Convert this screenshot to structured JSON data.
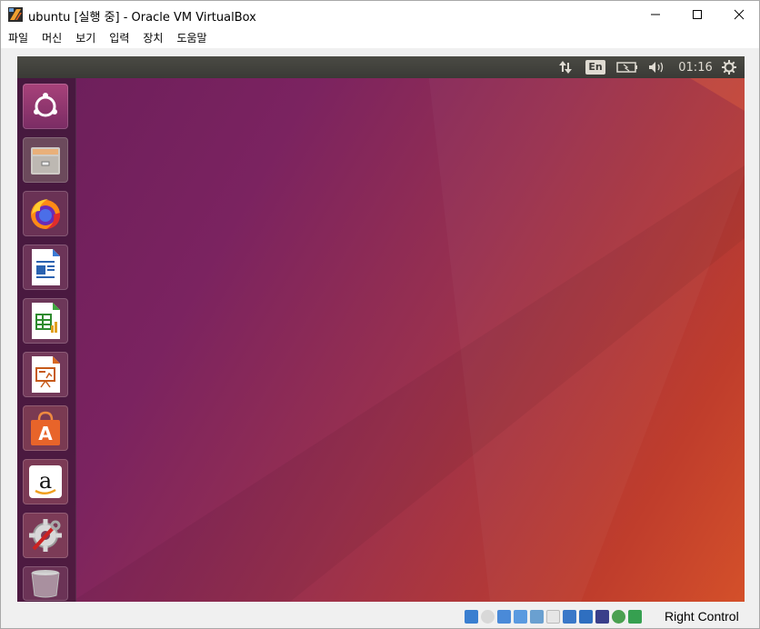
{
  "window": {
    "title": "ubuntu [실행 중] - Oracle VM VirtualBox"
  },
  "menu": [
    "파일",
    "머신",
    "보기",
    "입력",
    "장치",
    "도움말"
  ],
  "guest": {
    "panel": {
      "language": "En",
      "clock": "01:16"
    },
    "launcher": [
      {
        "name": "ubuntu-dash-icon"
      },
      {
        "name": "files-icon"
      },
      {
        "name": "firefox-icon"
      },
      {
        "name": "libreoffice-writer-icon"
      },
      {
        "name": "libreoffice-calc-icon"
      },
      {
        "name": "libreoffice-impress-icon"
      },
      {
        "name": "ubuntu-software-icon"
      },
      {
        "name": "amazon-icon"
      },
      {
        "name": "system-settings-icon"
      },
      {
        "name": "trash-icon"
      }
    ],
    "colors": {
      "panel": "#3c3b37",
      "wallpaper_start": "#6a1e5a",
      "wallpaper_end": "#d4502a"
    }
  },
  "statusbar": {
    "host_key": "Right Control"
  }
}
